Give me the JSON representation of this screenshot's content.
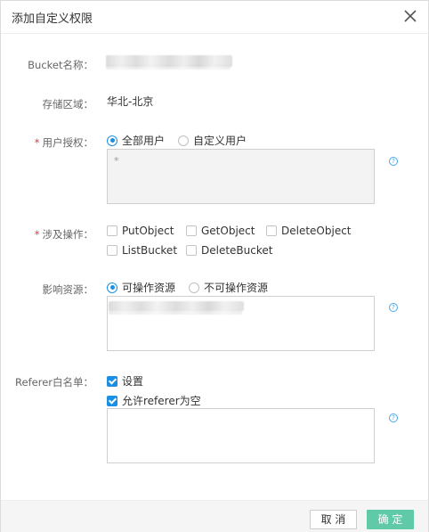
{
  "dialog": {
    "title": "添加自定义权限",
    "close_icon": "close-icon"
  },
  "bucket": {
    "label": "Bucket名称：",
    "value_redacted": true
  },
  "region": {
    "label": "存储区域：",
    "value": "华北-北京"
  },
  "user_auth": {
    "required_mark": "*",
    "label": "用户授权：",
    "options": [
      {
        "label": "全部用户",
        "selected": true
      },
      {
        "label": "自定义用户",
        "selected": false
      }
    ],
    "textarea_value": "*",
    "textarea_disabled": true,
    "help_icon": "help-icon"
  },
  "operations": {
    "required_mark": "*",
    "label": "涉及操作：",
    "items": [
      {
        "label": "PutObject",
        "checked": false
      },
      {
        "label": "GetObject",
        "checked": false
      },
      {
        "label": "DeleteObject",
        "checked": false
      },
      {
        "label": "ListBucket",
        "checked": false
      },
      {
        "label": "DeleteBucket",
        "checked": false
      }
    ]
  },
  "resources": {
    "label": "影响资源：",
    "options": [
      {
        "label": "可操作资源",
        "selected": true
      },
      {
        "label": "不可操作资源",
        "selected": false
      }
    ],
    "textarea_value_redacted": true,
    "help_icon": "help-icon"
  },
  "referer": {
    "label": "Referer白名单：",
    "checks": [
      {
        "label": "设置",
        "checked": true
      },
      {
        "label": "允许referer为空",
        "checked": true
      }
    ],
    "textarea_value": "",
    "help_icon": "help-icon"
  },
  "footer": {
    "cancel_label": "取 消",
    "ok_label": "确 定"
  },
  "colors": {
    "accent": "#1a8fe3",
    "ok_button": "#5fc9a8",
    "required": "#e4393c"
  }
}
